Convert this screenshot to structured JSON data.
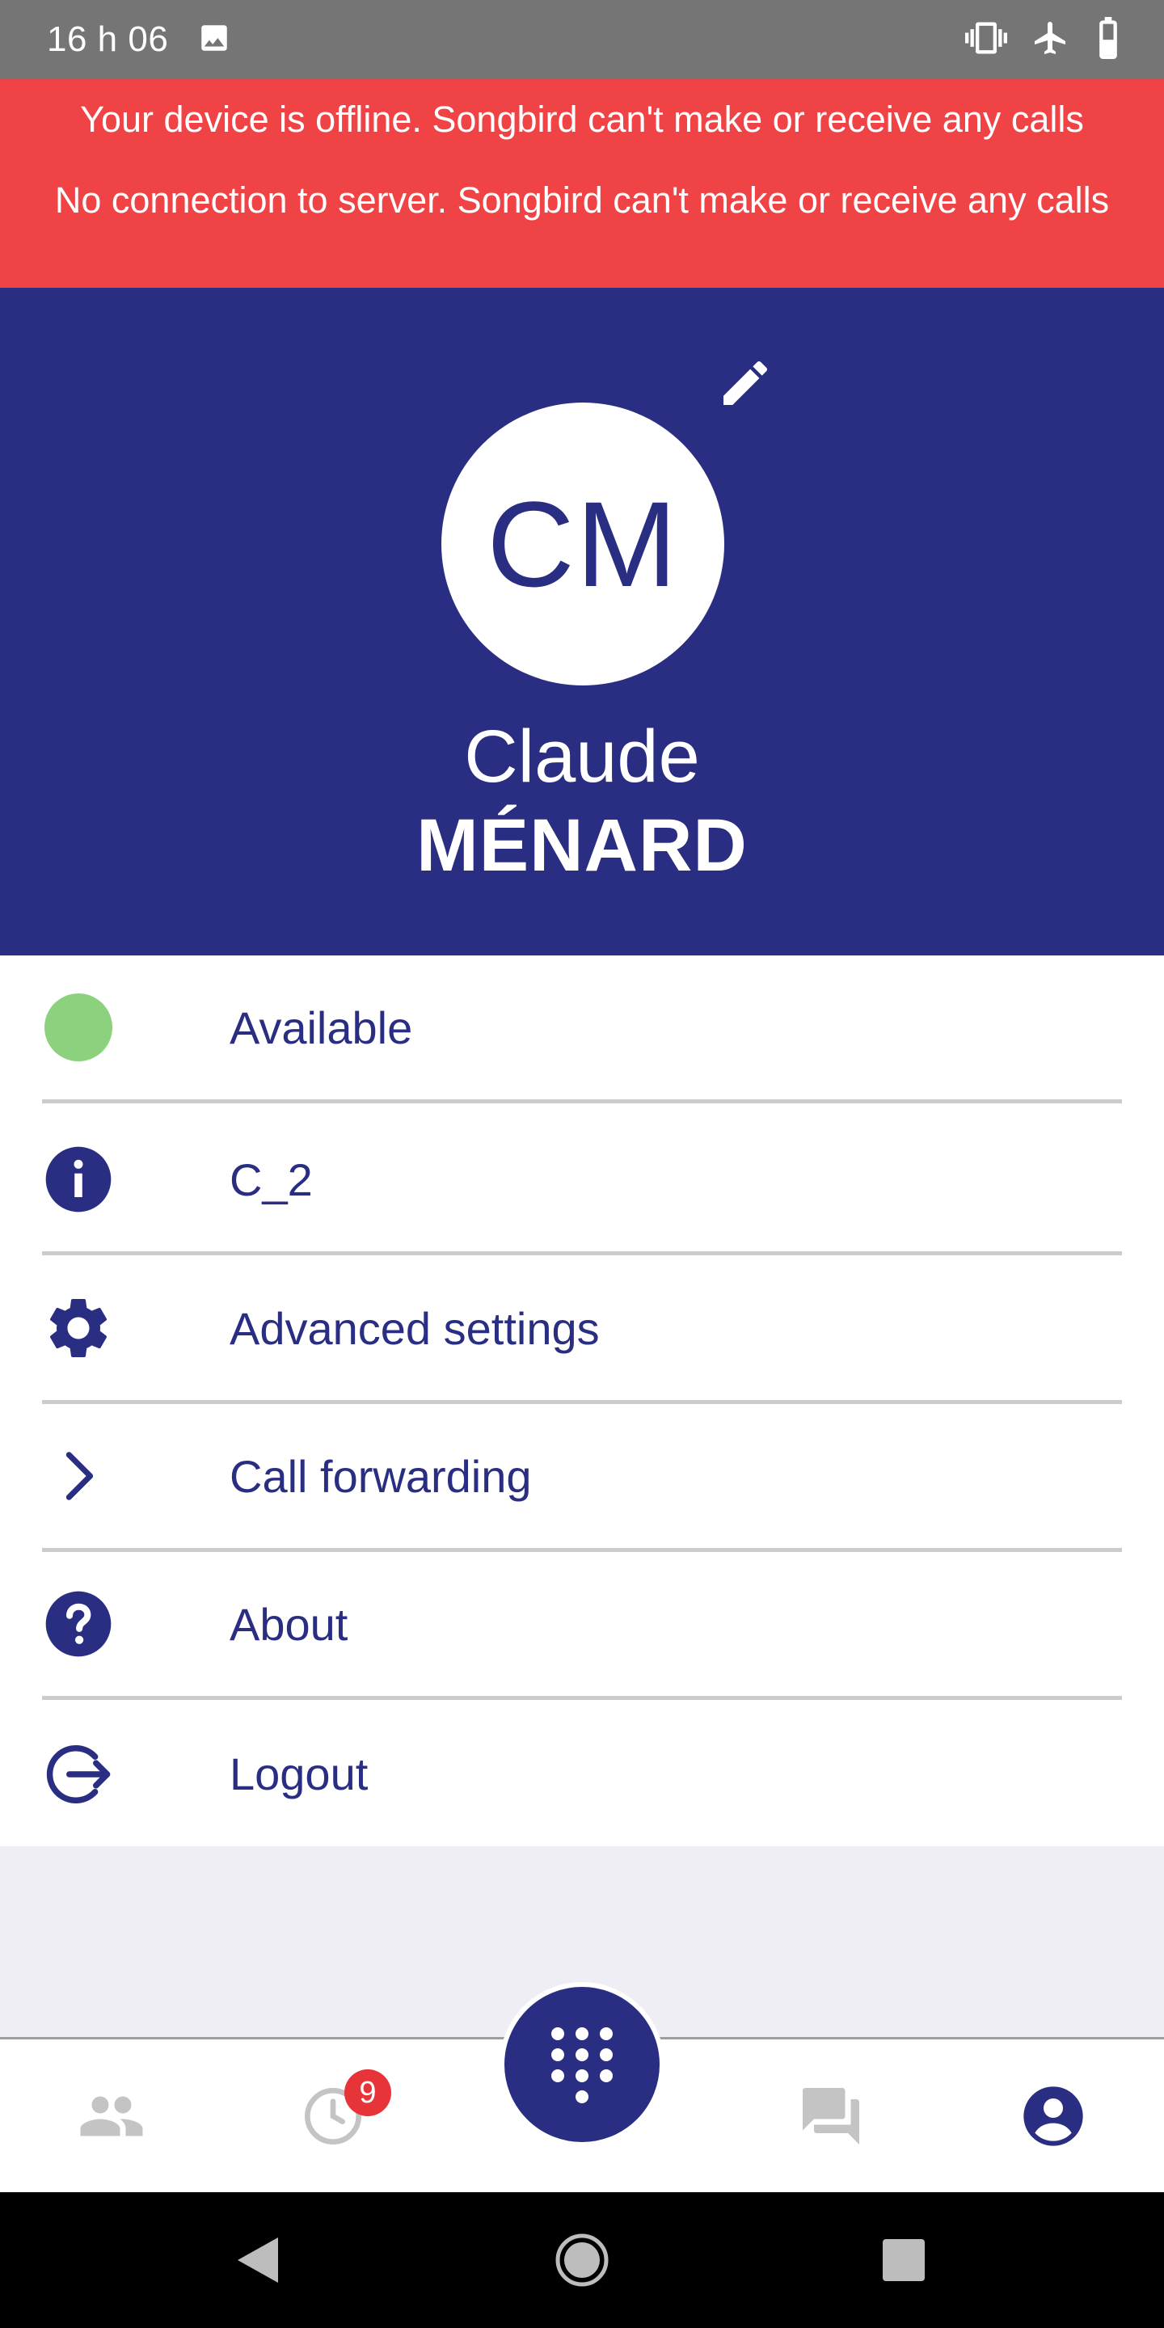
{
  "status_bar": {
    "time": "16 h 06",
    "icons": [
      "image-icon",
      "vibrate-icon",
      "airplane-icon",
      "battery-icon"
    ]
  },
  "alerts": {
    "offline": "Your device is offline. Songbird can't make or receive any calls",
    "server": "No connection to server. Songbird can't make or receive any calls"
  },
  "profile": {
    "initials": "CM",
    "first_name": "Claude",
    "last_name": "MÉNARD"
  },
  "menu": {
    "items": [
      {
        "label": "Available",
        "icon": "status-dot-icon",
        "color": "#8CD17D"
      },
      {
        "label": "C_2",
        "icon": "info-icon"
      },
      {
        "label": "Advanced settings",
        "icon": "gear-icon"
      },
      {
        "label": "Call forwarding",
        "icon": "chevron-right-icon"
      },
      {
        "label": "About",
        "icon": "help-icon"
      },
      {
        "label": "Logout",
        "icon": "logout-icon"
      }
    ]
  },
  "bottom_nav": {
    "history_badge": "9",
    "items": [
      "contacts-icon",
      "history-icon",
      "dialpad-icon",
      "messages-icon",
      "profile-icon"
    ]
  },
  "colors": {
    "primary": "#2A2E82",
    "alert": "#F04346",
    "badge": "#E63439",
    "inactive": "#C4C4C4"
  }
}
